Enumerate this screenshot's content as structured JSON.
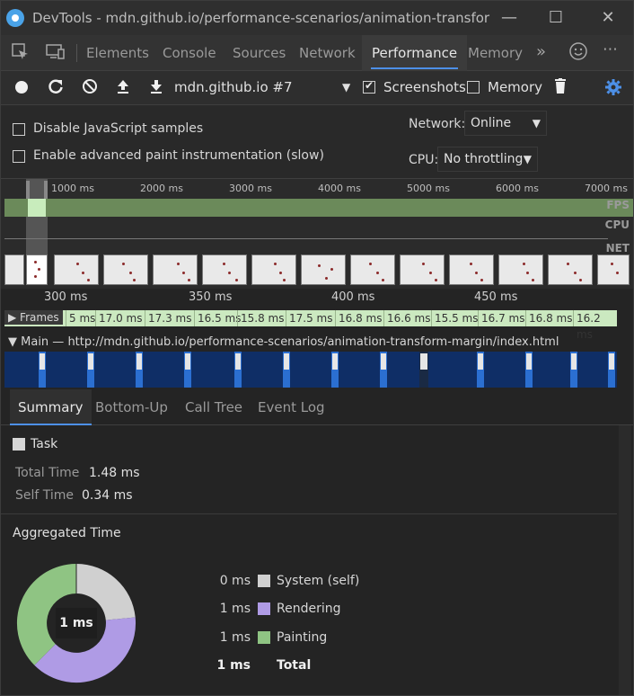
{
  "window": {
    "title": "DevTools - mdn.github.io/performance-scenarios/animation-transform-...",
    "minimize": "—",
    "maximize": "☐",
    "close": "✕"
  },
  "tabs": [
    "Elements",
    "Console",
    "Sources",
    "Network",
    "Performance",
    "Memory"
  ],
  "active_tab": "Performance",
  "toolbar": {
    "recording_target": "mdn.github.io #7",
    "screenshots_label": "Screenshots",
    "screenshots_checked": true,
    "memory_label": "Memory",
    "memory_checked": false
  },
  "settings": {
    "disable_js_samples": "Disable JavaScript samples",
    "advanced_paint": "Enable advanced paint instrumentation (slow)",
    "network_label": "Network:",
    "network_value": "Online",
    "cpu_label": "CPU:",
    "cpu_value": "No throttling"
  },
  "overview": {
    "ruler": [
      "1000 ms",
      "2000 ms",
      "3000 ms",
      "4000 ms",
      "5000 ms",
      "6000 ms",
      "7000 ms"
    ],
    "tracks": [
      "FPS",
      "CPU",
      "NET"
    ]
  },
  "detail": {
    "ruler": [
      "300 ms",
      "350 ms",
      "400 ms",
      "450 ms"
    ],
    "frames_label": "Frames",
    "frames": [
      "5 ms",
      "17.0 ms",
      "17.3 ms",
      "16.5 ms",
      "15.8 ms",
      "17.5 ms",
      "16.8 ms",
      "16.6 ms",
      "15.5 ms",
      "16.7 ms",
      "16.8 ms",
      "16.2 ms"
    ],
    "main_label": "Main — http://mdn.github.io/performance-scenarios/animation-transform-margin/index.html"
  },
  "summary": {
    "tabs": [
      "Summary",
      "Bottom-Up",
      "Call Tree",
      "Event Log"
    ],
    "active_tab": "Summary",
    "task_name": "Task",
    "total_time_label": "Total Time",
    "total_time_value": "1.48 ms",
    "self_time_label": "Self Time",
    "self_time_value": "0.34 ms",
    "aggregated_title": "Aggregated Time",
    "donut_center": "1 ms",
    "legend": [
      {
        "value": "0 ms",
        "name": "System (self)",
        "color": "#d0d0d0"
      },
      {
        "value": "1 ms",
        "name": "Rendering",
        "color": "#af9be5"
      },
      {
        "value": "1 ms",
        "name": "Painting",
        "color": "#8fc483"
      }
    ],
    "total_value": "1 ms",
    "total_label": "Total"
  },
  "colors": {
    "accent": "#4d90e8",
    "rendering": "#af9be5",
    "painting": "#8fc483",
    "system": "#d0d0d0"
  }
}
